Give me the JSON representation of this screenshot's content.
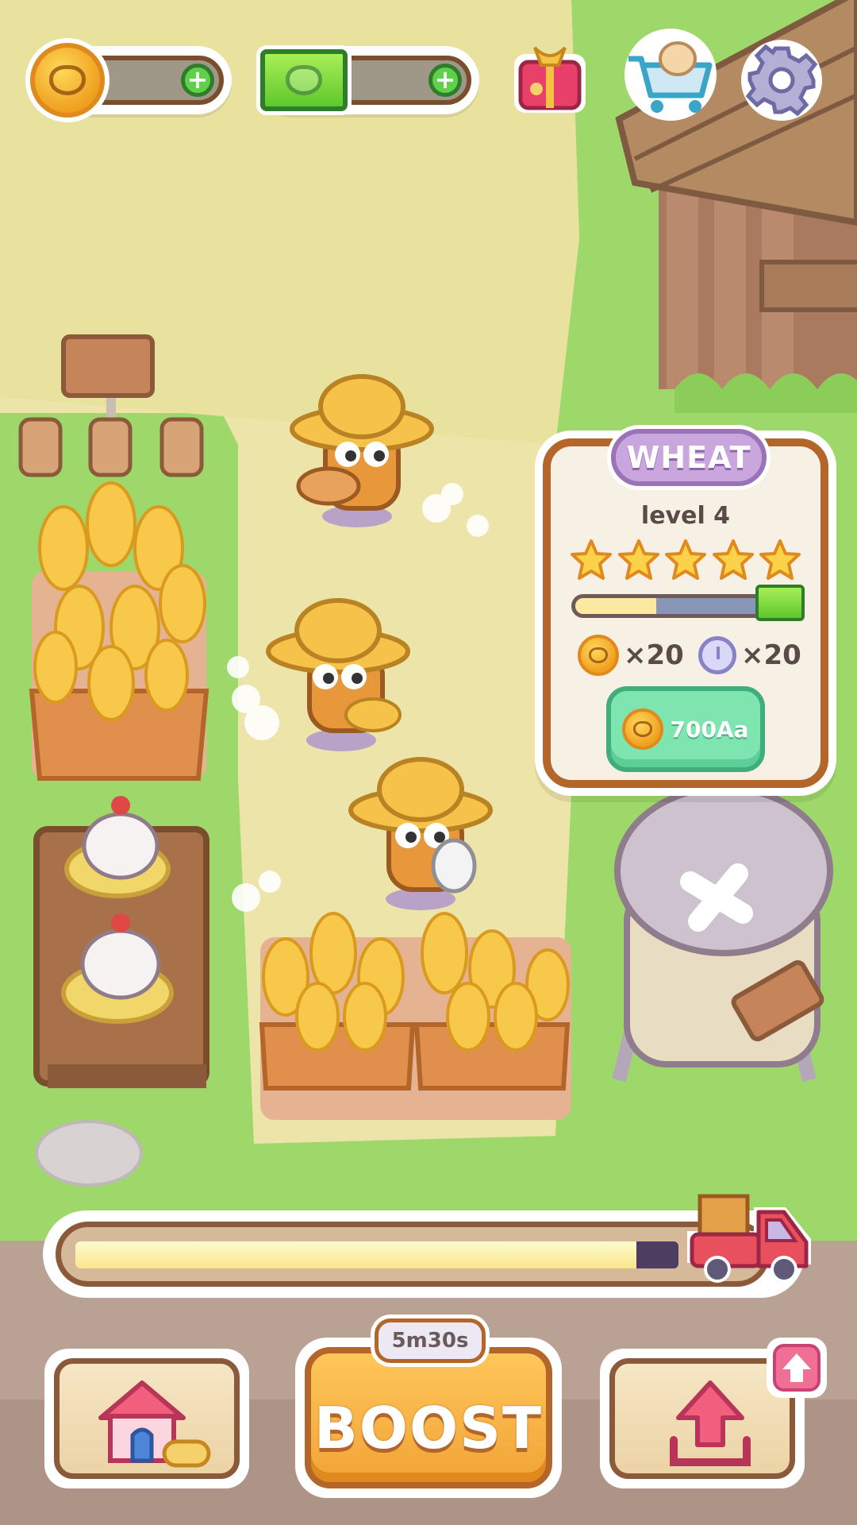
{
  "hud": {
    "coin_counter": {
      "icon": "pig-coin-icon",
      "value": ""
    },
    "cash_counter": {
      "icon": "pig-cash-icon",
      "value": ""
    },
    "buttons": [
      "gift-icon",
      "shop-cart-icon",
      "settings-gear-icon"
    ]
  },
  "info_panel": {
    "title": "WHEAT",
    "level": "level 4",
    "stars_filled": 5,
    "stars_total": 5,
    "upgrade_progress": 0.4,
    "coin_multiplier": "×20",
    "time_multiplier": "×20",
    "upgrade_cost": "700Aa"
  },
  "delivery": {
    "progress": 0.93
  },
  "bottom_bar": {
    "home_icon": "home-icon",
    "boost": {
      "label": "BOOST",
      "timer": "5m30s"
    },
    "upgrade_icon": "upload-arrow-icon",
    "upgrade_badge_icon": "arrow-up-icon"
  },
  "colors": {
    "grass": "#9fd86a",
    "path": "#ebe3a6",
    "accent_orange": "#f1a437",
    "panel_title": "#c9a7de",
    "buy_green": "#7ee4b0"
  }
}
